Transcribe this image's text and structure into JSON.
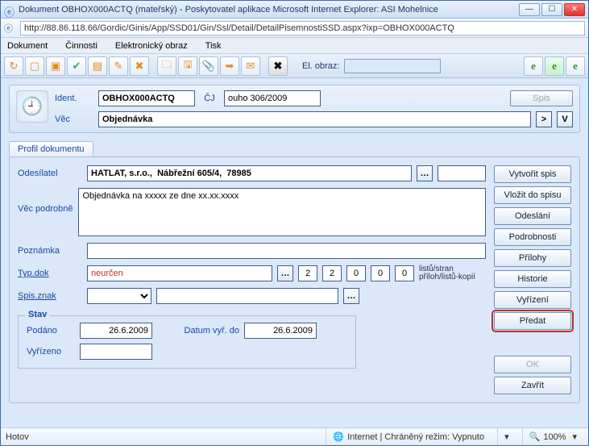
{
  "window": {
    "title": "Dokument OBHOX000ACTQ (mateřský) - Poskytovatel aplikace Microsoft Internet Explorer: ASI Mohelnice",
    "url": "http://88.86.118.66/Gordic/Ginis/App/SSD01/Gin/Ssl/Detail/DetailPisemnostiSSD.aspx?ixp=OBHOX000ACTQ"
  },
  "menu": {
    "m1": "Dokument",
    "m2": "Činnosti",
    "m3": "Elektronický obraz",
    "m4": "Tisk"
  },
  "toolbar": {
    "elobraz_label": "El. obraz:",
    "elobraz_value": ""
  },
  "header": {
    "ident_label": "Ident.",
    "ident_value": "OBHOX000ACTQ",
    "cj_label": "ČJ",
    "cj_value": "ouho 306/2009",
    "spis_btn": "Spis",
    "vec_label": "Věc",
    "vec_value": "Objednávka",
    "gt": ">",
    "v": "V"
  },
  "tab": {
    "profil": "Profil dokumentu"
  },
  "form": {
    "odesilatel_label": "Odesílatel",
    "odesilatel_value": "HATLAT, s.r.o.,  Nábřežní 605/4,  78985",
    "vecpodrobne_label": "Věc podrobně",
    "vecpodrobne_value": "Objednávka na xxxxx ze dne xx.xx.xxxx",
    "poznamka_label": "Poznámka",
    "poznamka_value": "",
    "typdok_label": "Typ.dok",
    "typdok_value": "neurčen",
    "n1": "2",
    "n2": "2",
    "n3": "0",
    "n4": "0",
    "n5": "0",
    "listu_label1": "listů/stran",
    "listu_label2": "příloh/listů-kopií",
    "spisznak_label": "Spis.znak",
    "spisznak_value": "",
    "stav_legend": "Stav",
    "podano_label": "Podáno",
    "podano_value": "26.6.2009",
    "datvyr_label": "Datum vyř. do",
    "datvyr_value": "26.6.2009",
    "vyrizeno_label": "Vyřízeno",
    "vyrizeno_value": ""
  },
  "side": {
    "b1": "Vytvořit spis",
    "b2": "Vložit do spisu",
    "b3": "Odeslání",
    "b4": "Podrobnosti",
    "b5": "Přílohy",
    "b6": "Historie",
    "b7": "Vyřízení",
    "b8": "Předat",
    "ok": "OK",
    "zavrit": "Zavřít"
  },
  "status": {
    "hotovo": "Hotov",
    "zone": "Internet | Chráněný režim: Vypnuto",
    "zoom": "100%"
  }
}
